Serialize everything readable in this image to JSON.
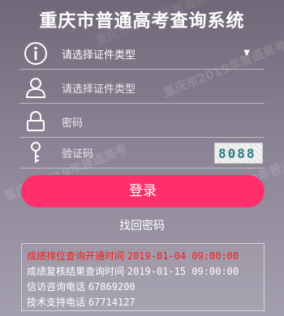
{
  "title": "重庆市普通高考查询系统",
  "watermark": "重庆市2019年普通高考",
  "form": {
    "type_select": {
      "value": "请选择证件类型",
      "icon": "info-icon"
    },
    "id_input": {
      "placeholder": "请选择证件类型",
      "icon": "user-icon"
    },
    "password_input": {
      "placeholder": "密码",
      "icon": "lock-icon"
    },
    "captcha_input": {
      "placeholder": "验证码",
      "icon": "key-icon",
      "captcha_text": "8088"
    },
    "login_label": "登录",
    "forgot_label": "找回密码"
  },
  "notice": {
    "line1": {
      "label": "成绩排位查询开通时间",
      "value": "2019-01-04 09:00:00",
      "color": "#ff1a1a"
    },
    "line2": {
      "label": "成绩复核结果查询时间",
      "value": "2019-01-15 09:00:00"
    },
    "line3": {
      "label": "信访咨询电话",
      "value": "67869200"
    },
    "line4": {
      "label": "技术支持电话",
      "value": "67714127"
    }
  },
  "colors": {
    "accent": "#ff2f6b",
    "highlight": "#ff1a1a"
  }
}
